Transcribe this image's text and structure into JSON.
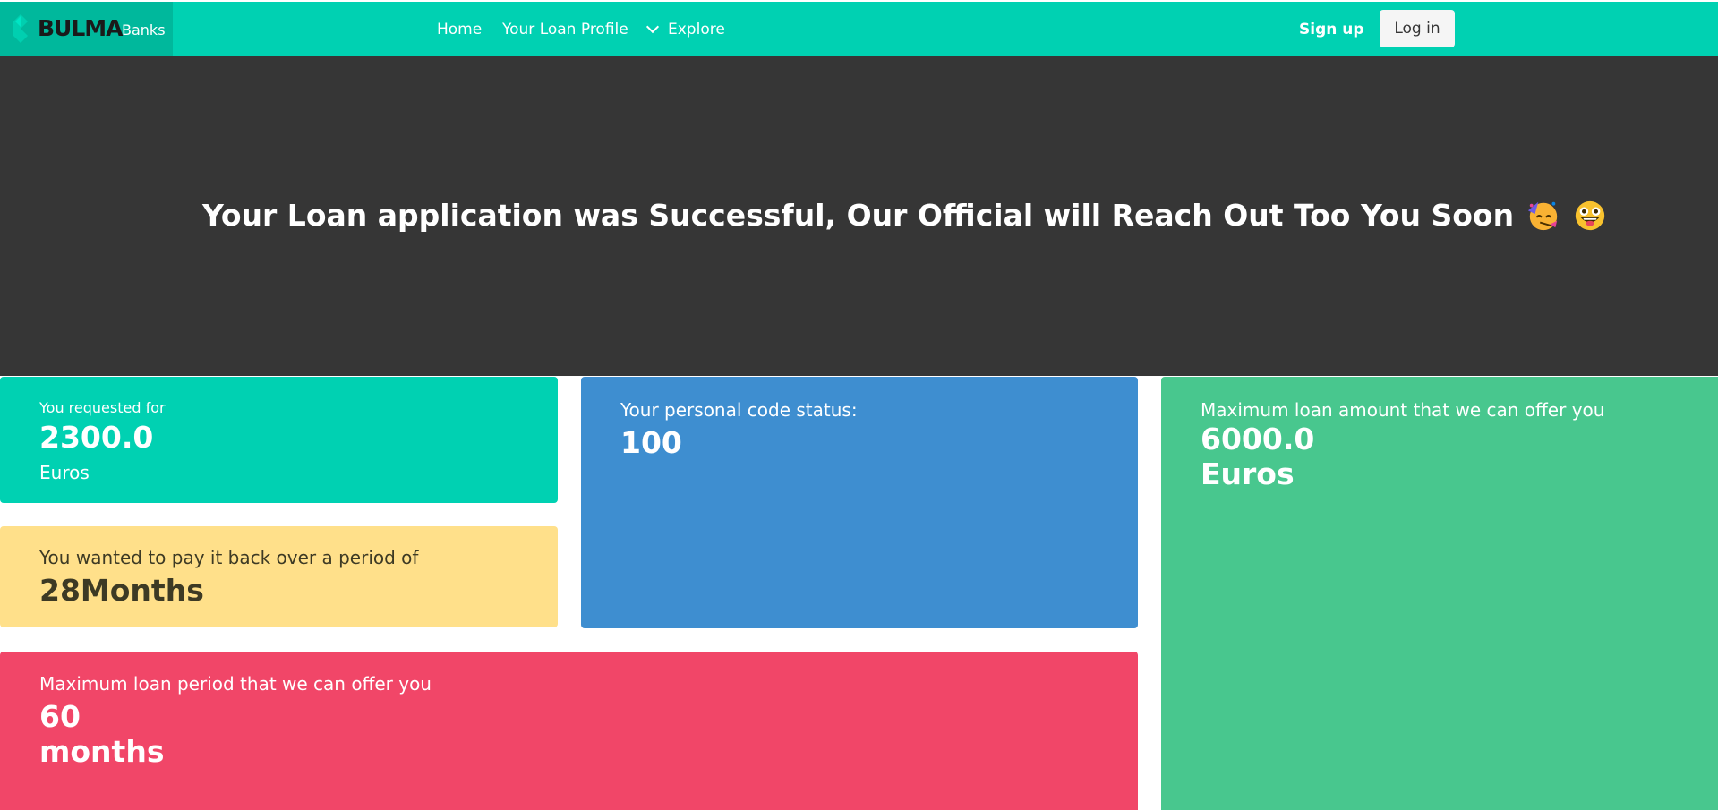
{
  "navbar": {
    "brand": "BULMA",
    "brand_suffix": "Banks",
    "links": {
      "home": "Home",
      "profile": "Your Loan Profile",
      "explore": "Explore"
    },
    "signup": "Sign up",
    "login": "Log in",
    "colors": {
      "bar": "#00d1b2",
      "brand_bg": "#00b89c"
    }
  },
  "hero": {
    "title": "Your Loan application was Successful, Our Official will Reach Out Too You Soon",
    "emojis": [
      "partying-face-icon",
      "grinning-zany-face-icon"
    ],
    "color": "#363636"
  },
  "tiles": {
    "requested": {
      "label": "You requested for",
      "amount": "2300.0",
      "unit": "Euros",
      "color": "#00d1b2"
    },
    "code_status": {
      "label": "Your personal code status:",
      "value": "100",
      "color": "#3e8ed0"
    },
    "max_amount": {
      "label": "Maximum loan amount that we can offer you",
      "amount": "6000.0",
      "unit": "Euros",
      "color": "#48c78e"
    },
    "period": {
      "label": "You wanted to pay it back over a period of",
      "value": "28Months",
      "color": "#ffe08a"
    },
    "max_period": {
      "label": "Maximum loan period that we can offer you",
      "value": "60",
      "unit": "months",
      "color": "#f14668"
    }
  }
}
